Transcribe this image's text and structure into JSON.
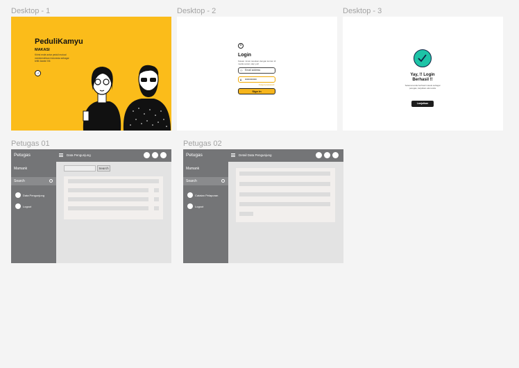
{
  "frames": {
    "desktop1": {
      "label": "Desktop - 1",
      "brand": "PeduliKamyu",
      "subtitle": "MAKASI",
      "description": "Kirimi ende antar peduli mutual membersihkan Indonesia sebagai kritik kawan trik",
      "arrow": "→"
    },
    "desktop2": {
      "label": "Desktop - 2",
      "close": "×",
      "title": "Login",
      "description": "Kawan minat masukan dengan konten di media sosial, siap yuk!",
      "email_placeholder": "Email address",
      "password_value": "●●●●●●●●",
      "forgot": "Forgot password",
      "signin": "Sign In"
    },
    "desktop3": {
      "label": "Desktop - 3",
      "title": "Yay, !! Login Berhasil !!",
      "description": "Selamat anda berhasil masuk sebagai petugas, lanjutkan aksi anda",
      "button": "Lanjutkan"
    },
    "petugas01": {
      "label": "Petugas 01",
      "app_title": "Petugas",
      "user": "Mamank",
      "search": "Search",
      "nav": [
        "Data Pengunjung",
        "Logout"
      ],
      "breadcrumb": "Data Pengunjung",
      "search_button": "Search"
    },
    "petugas02": {
      "label": "Petugas 02",
      "app_title": "Petugas",
      "user": "Mamank",
      "search": "Search",
      "nav": [
        "Catatan Pelaporan",
        "Logout"
      ],
      "breadcrumb": "Detail Data Pengunjung"
    }
  },
  "colors": {
    "accent_yellow": "#fbbc1a",
    "success_teal": "#1dc3a6",
    "sidebar_gray": "#747577",
    "canvas": "#f4f4f4"
  }
}
